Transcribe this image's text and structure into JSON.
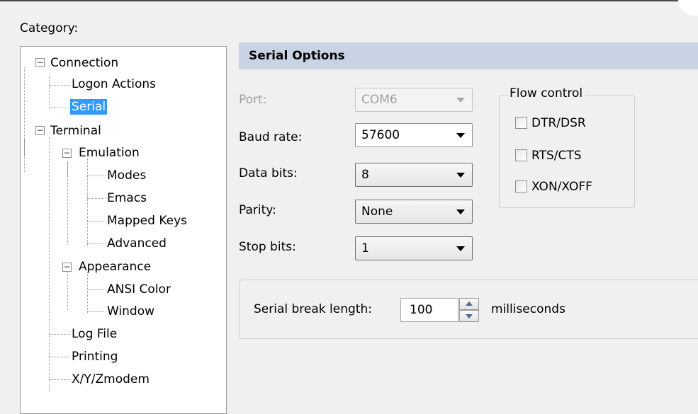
{
  "category_label": "Category:",
  "tree": {
    "connection": "Connection",
    "logon_actions": "Logon Actions",
    "serial": "Serial",
    "terminal": "Terminal",
    "emulation": "Emulation",
    "modes": "Modes",
    "emacs": "Emacs",
    "mapped_keys": "Mapped Keys",
    "advanced": "Advanced",
    "appearance": "Appearance",
    "ansi_color": "ANSI Color",
    "window": "Window",
    "log_file": "Log File",
    "printing": "Printing",
    "xyzmodem": "X/Y/Zmodem",
    "expanded_symbol": "−"
  },
  "serial_options": {
    "header": "Serial Options",
    "port": {
      "label": "Port:",
      "value": "COM6",
      "enabled": false
    },
    "baud_rate": {
      "label": "Baud rate:",
      "value": "57600"
    },
    "data_bits": {
      "label": "Data bits:",
      "value": "8"
    },
    "parity": {
      "label": "Parity:",
      "value": "None"
    },
    "stop_bits": {
      "label": "Stop bits:",
      "value": "1"
    }
  },
  "flow_control": {
    "legend": "Flow control",
    "dtr_dsr": {
      "label": "DTR/DSR",
      "checked": false
    },
    "rts_cts": {
      "label": "RTS/CTS",
      "checked": false
    },
    "xon_xoff": {
      "label": "XON/XOFF",
      "checked": false
    }
  },
  "serial_break": {
    "label": "Serial break length:",
    "value": "100",
    "unit": "milliseconds"
  },
  "colors": {
    "selection": "#3399ff",
    "header_bg": "#c8d4e4",
    "window_bg": "#f0f0f0"
  }
}
